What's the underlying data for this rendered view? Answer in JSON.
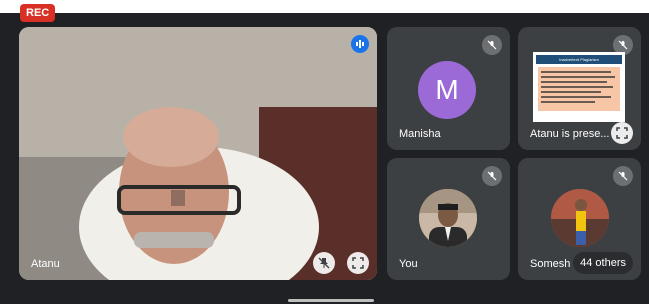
{
  "recording": {
    "label": "REC"
  },
  "main": {
    "name": "Atanu"
  },
  "tiles": [
    {
      "name": "Manisha",
      "initial": "M",
      "avatar_color": "#9c6ad7"
    },
    {
      "name": "Atanu is prese..."
    },
    {
      "name": "You"
    },
    {
      "name": "Somesh"
    }
  ],
  "slide": {
    "title": "Inadvertent Plagiarism",
    "bullets": [
      "",
      "",
      "",
      "",
      "",
      "",
      ""
    ]
  },
  "others": {
    "label": "44 others"
  },
  "icons": [
    "mic-off-icon",
    "fullscreen-icon",
    "pin-off-icon",
    "audio-indicator-icon"
  ],
  "colors": {
    "background": "#202124",
    "tile": "#3c4043",
    "rec": "#d93025",
    "accent": "#1a73e8"
  }
}
